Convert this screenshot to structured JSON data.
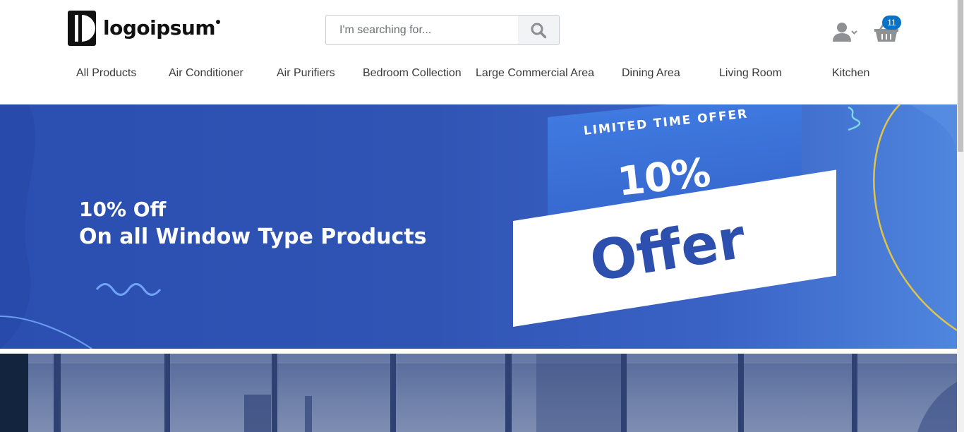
{
  "header": {
    "logo_text": "logoipsum",
    "search": {
      "placeholder": "I'm searching for...",
      "value": ""
    },
    "cart_count": "11",
    "icons": {
      "search": "search-icon",
      "user": "user-icon",
      "cart": "basket-icon",
      "chevron": "chevron-down-icon"
    }
  },
  "nav": {
    "items": [
      "All Products",
      "Air Conditioner",
      "Air Purifiers",
      "Bedroom Collection",
      "Large Commercial Area",
      "Dining Area",
      "Living Room",
      "Kitchen"
    ]
  },
  "banner": {
    "headline_line1": "10% Off",
    "headline_line2": "On all Window Type Products",
    "badge_top": "LIMITED TIME OFFER",
    "badge_percent": "10%",
    "badge_word": "Offer"
  },
  "colors": {
    "banner_blue": "#2f53b3",
    "accent_yellow": "#e0c44a",
    "badge_blue": "#0a72c4",
    "offer_text": "#2d4fae"
  }
}
